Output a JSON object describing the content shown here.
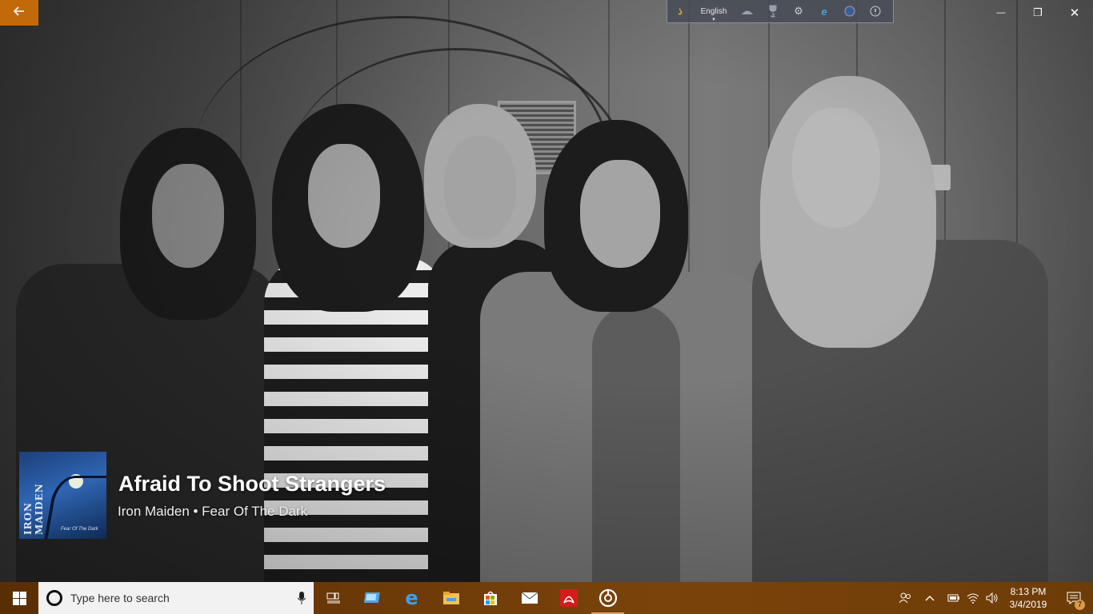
{
  "window": {
    "back_icon": "arrow-left-icon",
    "controls": {
      "minimize": "—",
      "restore": "❐",
      "close": "✕"
    }
  },
  "toolbar": {
    "language_label": "English",
    "icons": [
      "app-logo-icon",
      "language-icon",
      "hand-icon",
      "trophy-icon",
      "gear-icon",
      "internet-explorer-icon",
      "help-icon",
      "info-icon"
    ]
  },
  "now_playing": {
    "song_title": "Afraid To Shoot Strangers",
    "artist_album": "Iron Maiden • Fear Of The Dark",
    "album_art": {
      "band_text": "IRON MAIDEN",
      "album_text": "Fear Of The Dark"
    }
  },
  "taskbar": {
    "search_placeholder": "Type here to search",
    "apps": [
      "task-view-icon",
      "photos-icon",
      "edge-icon",
      "file-explorer-icon",
      "store-icon",
      "mail-icon",
      "acrobat-icon",
      "groove-music-icon"
    ],
    "active_app": "groove-music-icon",
    "clock": {
      "time": "8:13 PM",
      "date": "3/4/2019"
    },
    "notification_count": "7",
    "tray_icons": [
      "people-icon",
      "chevron-up-icon",
      "battery-icon",
      "wifi-icon",
      "volume-icon"
    ]
  },
  "colors": {
    "accent": "#c26a0a",
    "taskbar": "#6a3808"
  }
}
